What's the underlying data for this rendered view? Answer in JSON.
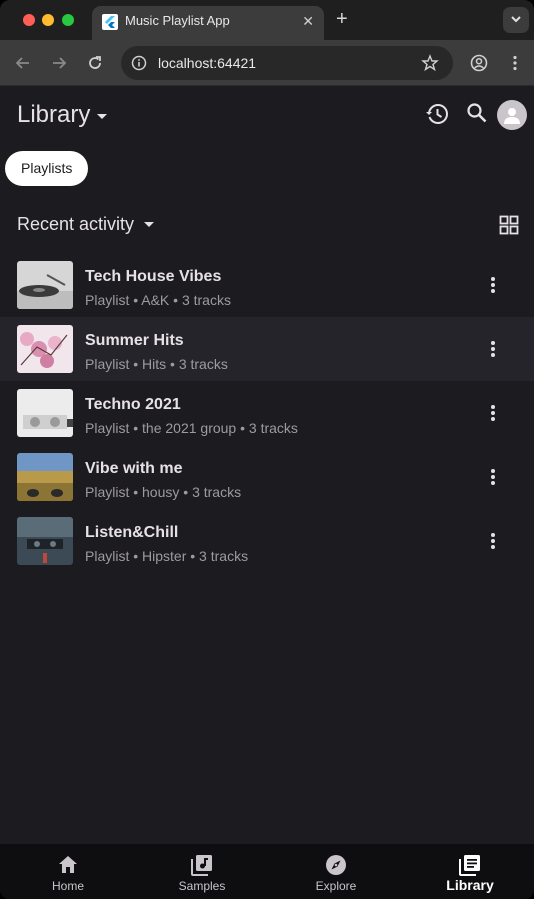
{
  "browser": {
    "tab_title": "Music Playlist App",
    "url": "localhost:64421",
    "icons": [
      "back-icon",
      "forward-icon",
      "reload-icon",
      "info-icon",
      "bookmark-star-icon",
      "profile-icon",
      "menu-kebab-icon",
      "tab-search-icon",
      "close-icon",
      "new-tab-icon"
    ]
  },
  "header": {
    "title": "Library",
    "icons": [
      "history-icon",
      "search-icon",
      "account-icon"
    ]
  },
  "filter_chip": {
    "label": "Playlists"
  },
  "section": {
    "title": "Recent activity",
    "view_toggle_icon": "grid-view-icon"
  },
  "playlists": [
    {
      "title": "Tech House Vibes",
      "subtitle": "Playlist • A&K • 3 tracks",
      "thumb_color": "#c8c8c8"
    },
    {
      "title": "Summer Hits",
      "subtitle": "Playlist • Hits • 3 tracks",
      "thumb_color": "#e8b4c8"
    },
    {
      "title": "Techno 2021",
      "subtitle": "Playlist • the 2021 group • 3 tracks",
      "thumb_color": "#d8d8d8"
    },
    {
      "title": "Vibe with me",
      "subtitle": "Playlist • housy • 3 tracks",
      "thumb_color": "#6b8fb8"
    },
    {
      "title": "Listen&Chill",
      "subtitle": "Playlist • Hipster • 3 tracks",
      "thumb_color": "#4a5560"
    }
  ],
  "bottom_nav": {
    "items": [
      {
        "label": "Home",
        "icon": "home-icon"
      },
      {
        "label": "Samples",
        "icon": "music-library-icon"
      },
      {
        "label": "Explore",
        "icon": "compass-icon"
      },
      {
        "label": "Library",
        "icon": "library-icon"
      }
    ],
    "active": "Library"
  },
  "colors": {
    "background": "#1c1b1f",
    "text_primary": "#e6e1e5",
    "text_secondary": "#9e9aa1",
    "chip_background": "#ffffff",
    "nav_background": "#0e0d10"
  }
}
